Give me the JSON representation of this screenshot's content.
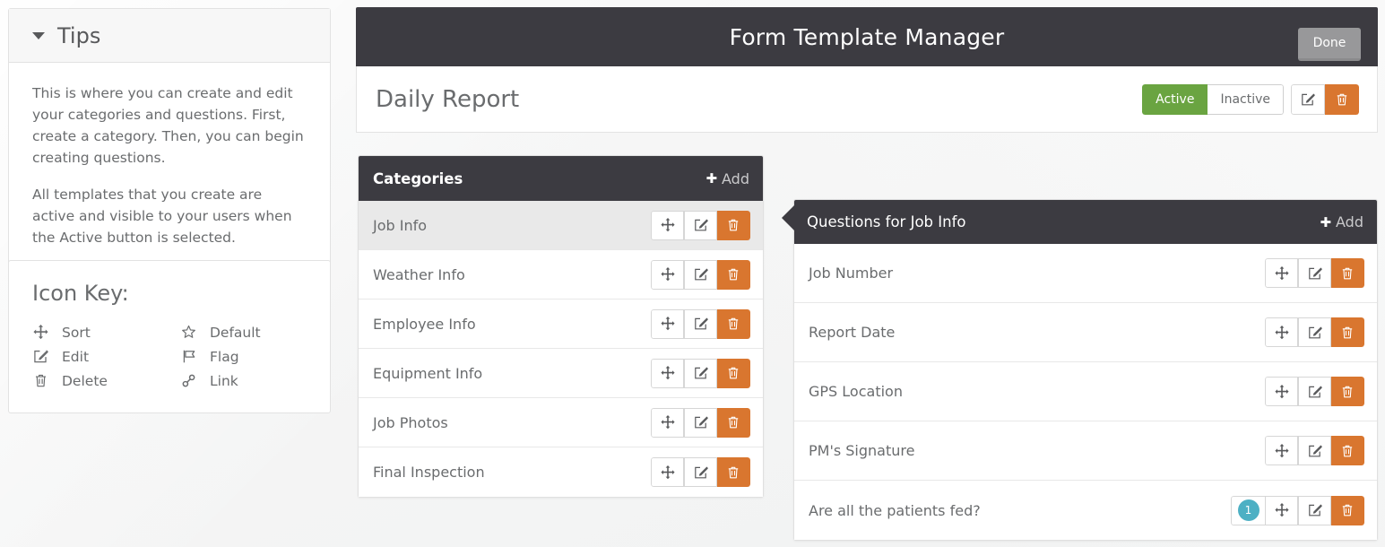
{
  "tips": {
    "title": "Tips",
    "caret_icon": "caret-down-icon",
    "paragraphs": [
      "This is where you can create and edit your categories and questions. First, create a category. Then, you can begin creating questions.",
      "All templates that you create are active and visible to your users when the Active button is selected."
    ]
  },
  "icon_key": {
    "title": "Icon Key:",
    "items": [
      {
        "icon": "move-arrows-icon",
        "label": "Sort"
      },
      {
        "icon": "star-outline-icon",
        "label": "Default"
      },
      {
        "icon": "pencil-square-icon",
        "label": "Edit"
      },
      {
        "icon": "flag-outline-icon",
        "label": "Flag"
      },
      {
        "icon": "trash-icon",
        "label": "Delete"
      },
      {
        "icon": "link-chain-icon",
        "label": "Link"
      }
    ]
  },
  "header": {
    "title": "Form Template Manager",
    "done_label": "Done"
  },
  "template_bar": {
    "name": "Daily Report",
    "active_label": "Active",
    "inactive_label": "Inactive",
    "active_selected": true,
    "edit_icon": "pencil-square-icon",
    "delete_icon": "trash-icon"
  },
  "categories": {
    "title": "Categories",
    "add_label": "Add",
    "add_icon": "plus-icon",
    "items": [
      {
        "label": "Job Info",
        "selected": true
      },
      {
        "label": "Weather Info",
        "selected": false
      },
      {
        "label": "Employee Info",
        "selected": false
      },
      {
        "label": "Equipment Info",
        "selected": false
      },
      {
        "label": "Job Photos",
        "selected": false
      },
      {
        "label": "Final Inspection",
        "selected": false
      }
    ]
  },
  "questions": {
    "title": "Questions for Job Info",
    "add_label": "Add",
    "add_icon": "plus-icon",
    "items": [
      {
        "label": "Job Number",
        "badge": null
      },
      {
        "label": "Report Date",
        "badge": null
      },
      {
        "label": "GPS Location",
        "badge": null
      },
      {
        "label": "PM's Signature",
        "badge": null
      },
      {
        "label": "Are all the patients fed?",
        "badge": "1"
      }
    ]
  },
  "colors": {
    "header_dark": "#3c3b41",
    "accent_orange": "#d9762f",
    "active_green": "#6aa441",
    "badge_teal": "#4db0c4",
    "done_gray": "#98989a"
  }
}
